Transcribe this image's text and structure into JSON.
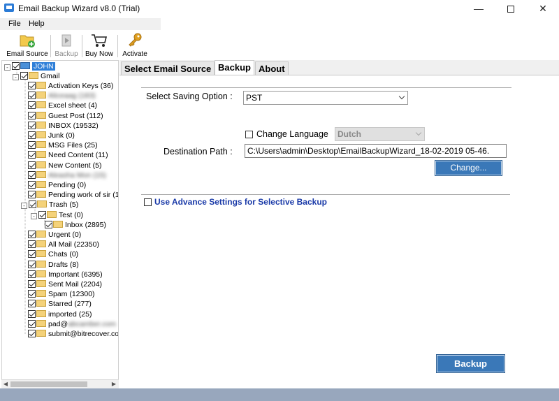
{
  "window": {
    "title": "Email Backup Wizard v8.0 (Trial)",
    "minimize": "—",
    "close": "✕"
  },
  "menu": [
    "File",
    "Help"
  ],
  "toolbar": {
    "email_source": "Email Source",
    "backup": "Backup",
    "buy_now": "Buy Now",
    "activate": "Activate"
  },
  "tree": {
    "root": "JOHN",
    "account": "Gmail",
    "folders": [
      {
        "label": "Activation Keys (36)",
        "level": 2
      },
      {
        "label": "Aliceaag (183)",
        "level": 2,
        "blurred": true
      },
      {
        "label": "Excel sheet (4)",
        "level": 2
      },
      {
        "label": "Guest Post (112)",
        "level": 2
      },
      {
        "label": "INBOX (19532)",
        "level": 2
      },
      {
        "label": "Junk (0)",
        "level": 2
      },
      {
        "label": "MSG Files (25)",
        "level": 2
      },
      {
        "label": "Need Content (11)",
        "level": 2
      },
      {
        "label": "New Content (5)",
        "level": 2
      },
      {
        "label": "Aleasha Mon (15)",
        "level": 2,
        "blurred": true
      },
      {
        "label": "Pending (0)",
        "level": 2
      },
      {
        "label": "Pending work of sir (1",
        "level": 2
      },
      {
        "label": "Trash (5)",
        "level": 2,
        "expander": "-"
      },
      {
        "label": "Test (0)",
        "level": 3,
        "expander": "-"
      },
      {
        "label": "Inbox (2895)",
        "level": 4
      },
      {
        "label": "Urgent (0)",
        "level": 2
      },
      {
        "label": "All Mail (22350)",
        "level": 2
      },
      {
        "label": "Chats (0)",
        "level": 2
      },
      {
        "label": "Drafts (8)",
        "level": 2
      },
      {
        "label": "Important (6395)",
        "level": 2
      },
      {
        "label": "Sent Mail (2204)",
        "level": 2
      },
      {
        "label": "Spam (12300)",
        "level": 2
      },
      {
        "label": "Starred (277)",
        "level": 2
      },
      {
        "label": "imported (25)",
        "level": 2
      },
      {
        "label": "pad@",
        "level": 2,
        "suffix_blurred": "abcamber.com"
      },
      {
        "label": "submit@bitrecover.co",
        "level": 2
      }
    ]
  },
  "tabs": [
    "Select Email Source",
    "Backup",
    "About"
  ],
  "backup": {
    "saving_option_label": "Select Saving Option  :",
    "saving_option_value": "PST",
    "change_language_label": "Change Language",
    "language_value": "Dutch",
    "destination_label": "Destination Path  :",
    "destination_value": "C:\\Users\\admin\\Desktop\\EmailBackupWizard_18-02-2019 05-46.",
    "change_button": "Change...",
    "advance_settings_label": "Use Advance Settings for Selective Backup",
    "backup_button": "Backup"
  }
}
